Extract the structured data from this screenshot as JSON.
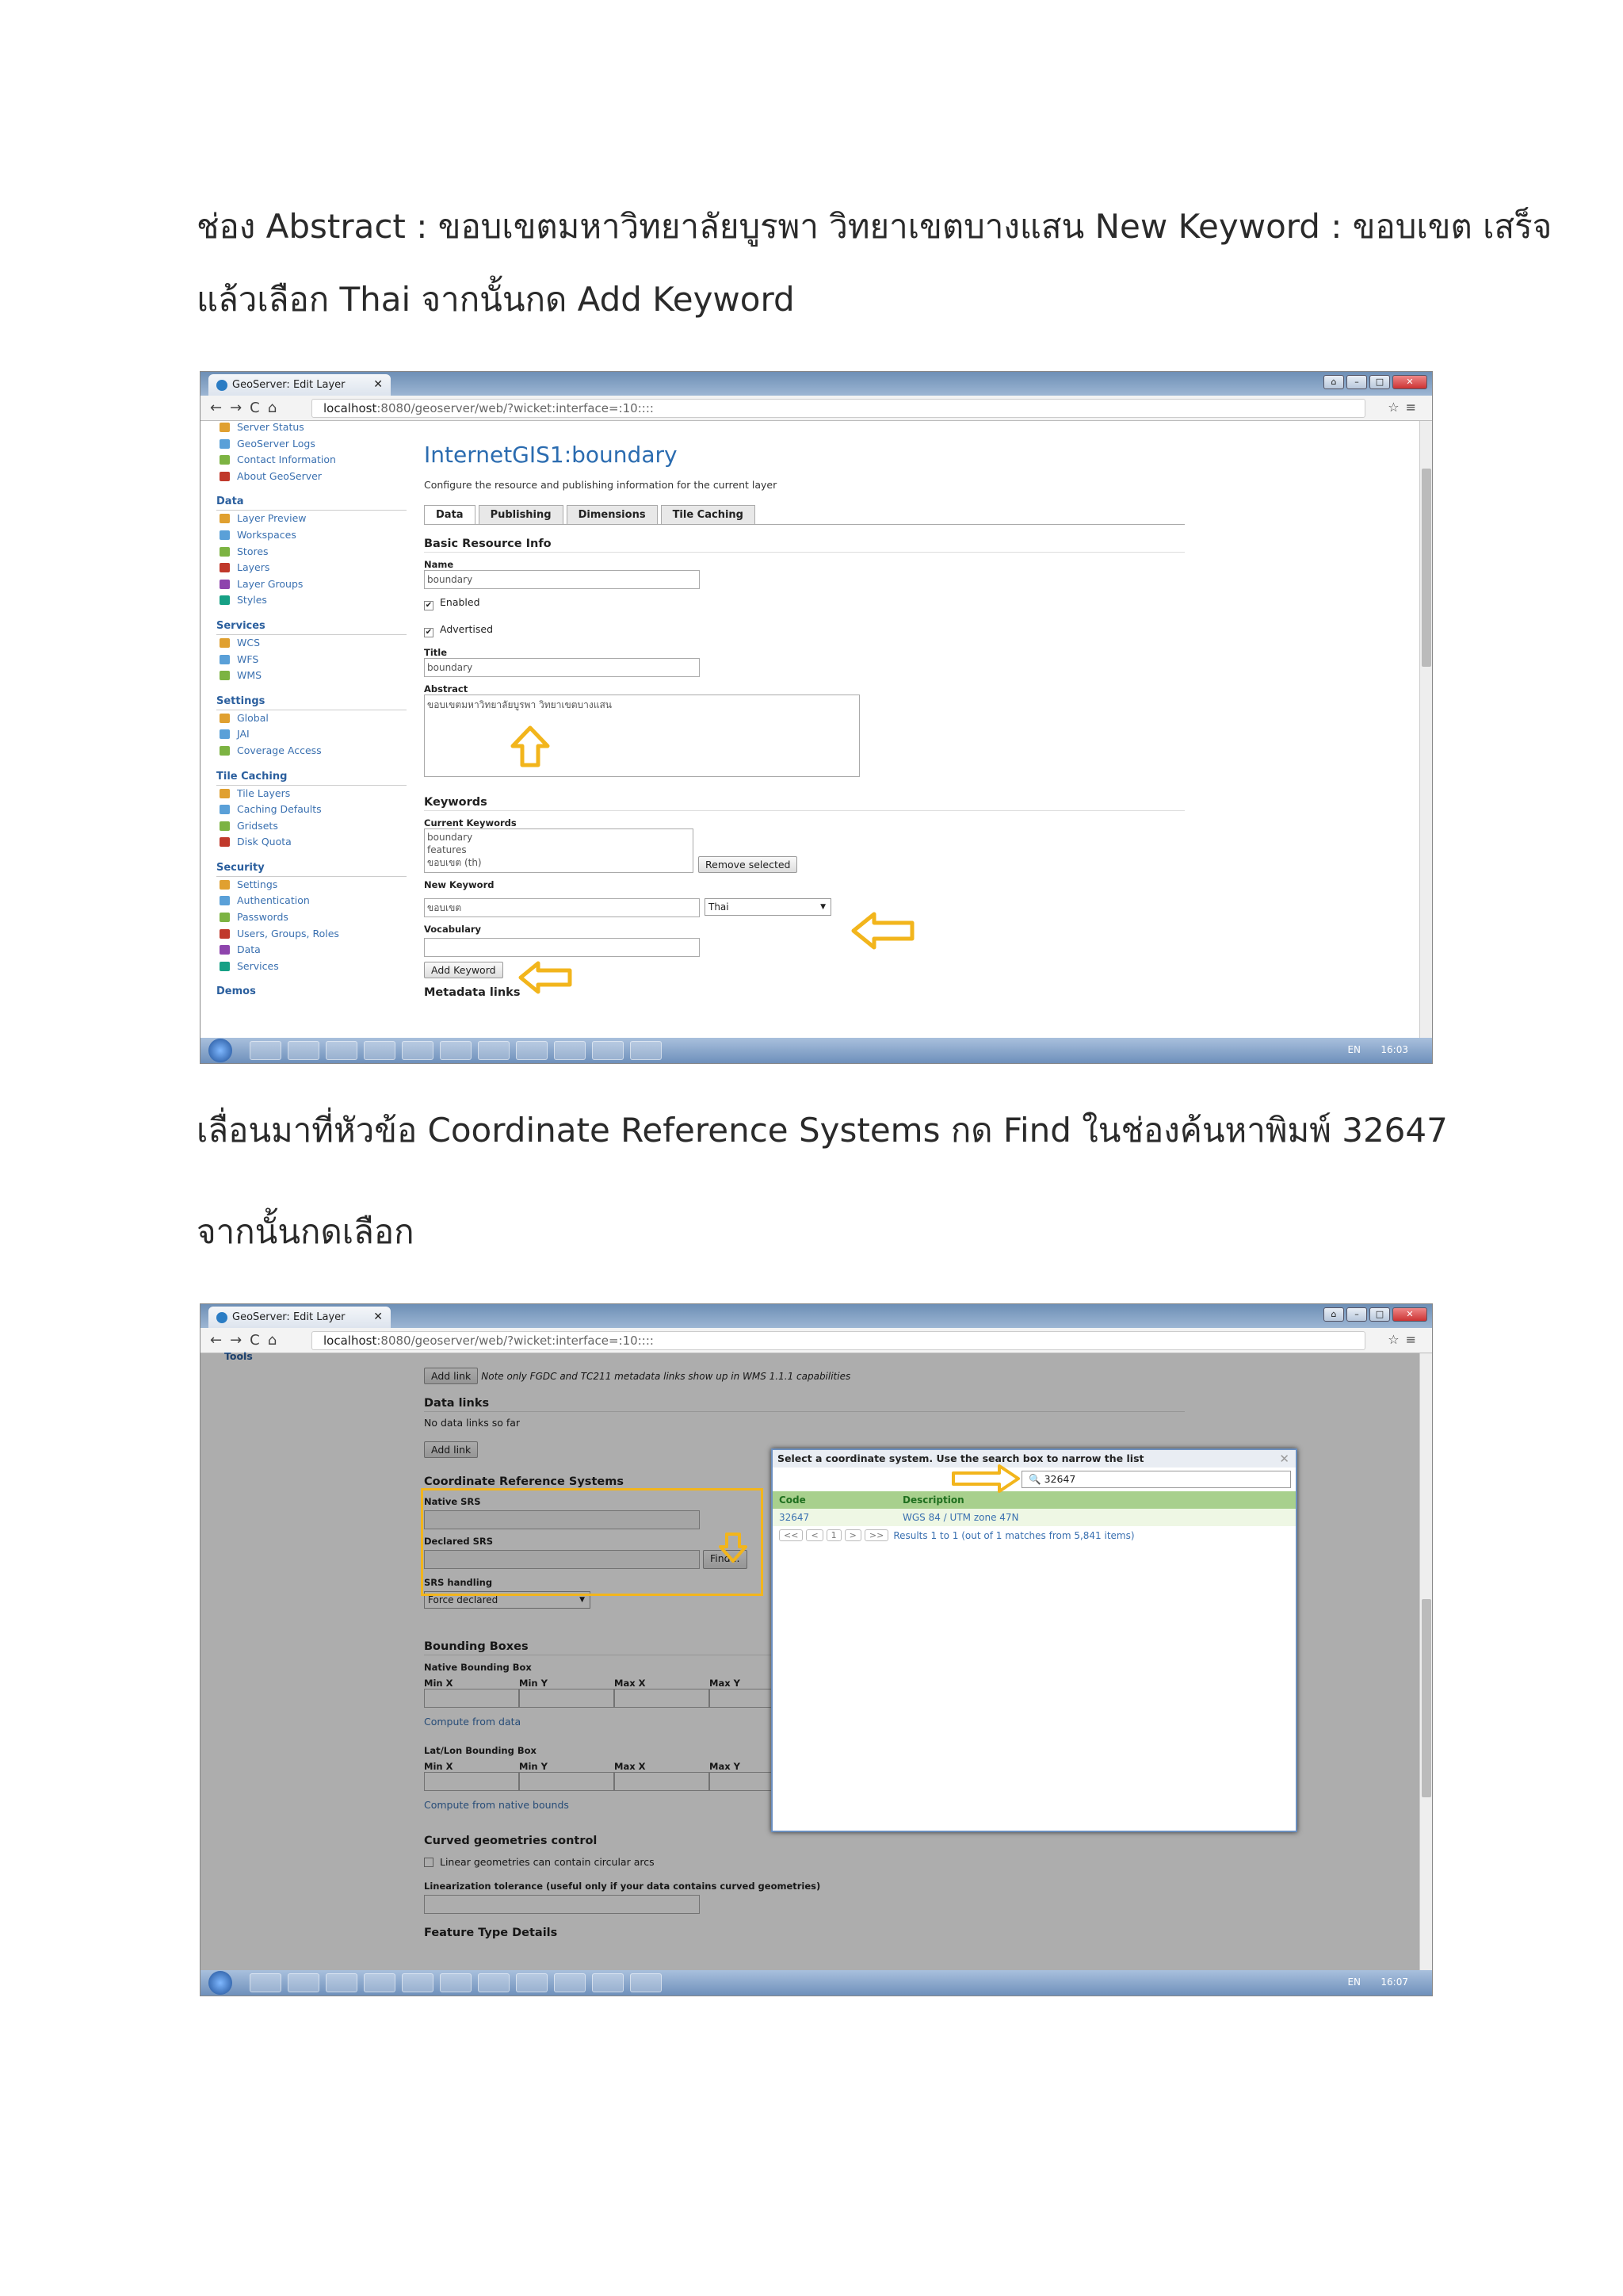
{
  "instructions": {
    "line1": "ช่อง Abstract : ขอบเขตมหาวิทยาลัยบูรพา วิทยาเขตบางแสน  New Keyword : ขอบเขต เสร็จ",
    "line2": "แล้วเลือก Thai จากนั้นกด Add Keyword",
    "line3": "เลื่อนมาที่หัวข้อ Coordinate Reference Systems กด Find ในช่องค้นหาพิมพ์ 32647",
    "line4": "จากนั้นกดเลือก"
  },
  "browser": {
    "tab_title": "GeoServer: Edit Layer",
    "url_host": "localhost",
    "url_path": ":8080/geoserver/web/?wicket:interface=:10::::",
    "clock1": "16:03",
    "clock2": "16:07",
    "lang": "EN"
  },
  "sidebar": {
    "top_items": [
      "Server Status",
      "GeoServer Logs",
      "Contact Information",
      "About GeoServer"
    ],
    "data_h": "Data",
    "data_items": [
      "Layer Preview",
      "Workspaces",
      "Stores",
      "Layers",
      "Layer Groups",
      "Styles"
    ],
    "services_h": "Services",
    "services_items": [
      "WCS",
      "WFS",
      "WMS"
    ],
    "settings_h": "Settings",
    "settings_items": [
      "Global",
      "JAI",
      "Coverage Access"
    ],
    "tile_h": "Tile Caching",
    "tile_items": [
      "Tile Layers",
      "Caching Defaults",
      "Gridsets",
      "Disk Quota"
    ],
    "security_h": "Security",
    "security_items": [
      "Settings",
      "Authentication",
      "Passwords",
      "Users, Groups, Roles",
      "Data",
      "Services"
    ],
    "demos": "Demos",
    "tools": "Tools"
  },
  "layer": {
    "title": "InternetGIS1:boundary",
    "subtitle": "Configure the resource and publishing information for the current layer",
    "tabs": [
      "Data",
      "Publishing",
      "Dimensions",
      "Tile Caching"
    ],
    "basic_info": "Basic Resource Info",
    "name_lbl": "Name",
    "name_val": "boundary",
    "enabled": "Enabled",
    "advertised": "Advertised",
    "title_lbl": "Title",
    "title_val": "boundary",
    "abstract_lbl": "Abstract",
    "abstract_val": "ขอบเขตมหาวิทยาลัยบูรพา วิทยาเขตบางแสน",
    "keywords": "Keywords",
    "current_kw_lbl": "Current Keywords",
    "current_kw": [
      "boundary",
      "features",
      "ขอบเขต (th)"
    ],
    "remove_btn": "Remove selected",
    "new_kw_lbl": "New Keyword",
    "new_kw_val": "ขอบเขต",
    "lang_val": "Thai",
    "vocab_lbl": "Vocabulary",
    "add_kw_btn": "Add Keyword",
    "metadata_links": "Metadata links"
  },
  "crs_page": {
    "add_link": "Add link",
    "note": "Note only FGDC and TC211 metadata links show up in WMS 1.1.1 capabilities",
    "data_links": "Data links",
    "no_data_links": "No data links so far",
    "add_link2": "Add link",
    "crs_h": "Coordinate Reference Systems",
    "native_srs": "Native SRS",
    "declared_srs": "Declared SRS",
    "find_btn": "Find...",
    "srs_handling": "SRS handling",
    "force_declared": "Force declared",
    "bbox_h": "Bounding Boxes",
    "native_bbox": "Native Bounding Box",
    "cols": [
      "Min X",
      "Min Y",
      "Max X",
      "Max Y"
    ],
    "compute_data": "Compute from data",
    "latlon_bbox": "Lat/Lon Bounding Box",
    "compute_native": "Compute from native bounds",
    "curved_h": "Curved geometries control",
    "linear": "Linear geometries can contain circular arcs",
    "lin_tol": "Linearization tolerance (useful only if your data contains curved geometries)",
    "feature_type": "Feature Type Details"
  },
  "dialog": {
    "title": "Select a coordinate system. Use the search box to narrow the list",
    "search_val": "32647",
    "col_code": "Code",
    "col_desc": "Description",
    "row_code": "32647",
    "row_desc": "WGS 84 / UTM zone 47N",
    "pager": [
      "<<",
      "<",
      "1",
      ">",
      ">>"
    ],
    "results": "Results 1 to 1 (out of 1 matches from 5,841 items)"
  },
  "colors": {
    "arrow": "#f2b51c",
    "link": "#3a70b0",
    "title_blue": "#2b6cb0",
    "grid_green": "#a8d08d"
  }
}
